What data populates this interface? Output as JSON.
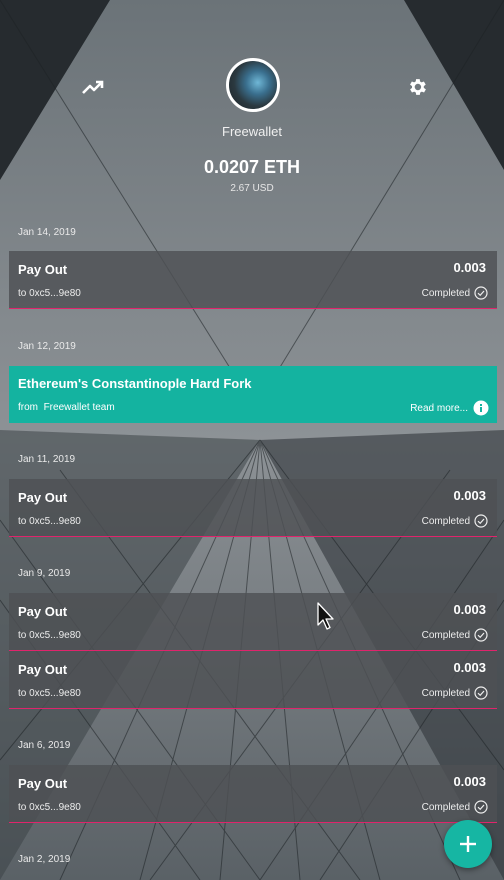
{
  "header": {
    "trend_icon": "trending-up-icon",
    "settings_icon": "gear-icon",
    "wallet_name": "Freewallet",
    "balance": "0.0207 ETH",
    "balance_fiat": "2.67 USD"
  },
  "groups": [
    {
      "date": "Jan 14, 2019"
    },
    {
      "date": "Jan 12, 2019"
    },
    {
      "date": "Jan 11, 2019"
    },
    {
      "date": "Jan 9, 2019"
    },
    {
      "date": "Jan 6, 2019"
    },
    {
      "date": "Jan 2, 2019"
    }
  ],
  "transactions": [
    {
      "title": "Pay Out",
      "amount": "0.003",
      "address": "to  0xc5...9e80",
      "status": "Completed"
    },
    {
      "title": "Pay Out",
      "amount": "0.003",
      "address": "to  0xc5...9e80",
      "status": "Completed"
    },
    {
      "title": "Pay Out",
      "amount": "0.003",
      "address": "to  0xc5...9e80",
      "status": "Completed"
    },
    {
      "title": "Pay Out",
      "amount": "0.003",
      "address": "to  0xc5...9e80",
      "status": "Completed"
    },
    {
      "title": "Pay Out",
      "amount": "0.003",
      "address": "to  0xc5...9e80",
      "status": "Completed"
    }
  ],
  "news": {
    "title": "Ethereum's Constantinople Hard Fork",
    "from_label": "from",
    "from": "Freewallet team",
    "read_more": "Read more...",
    "info_icon": "info-icon"
  },
  "fab_icon": "plus-icon",
  "colors": {
    "accent": "#14b3a0",
    "divider": "#e0246c",
    "card": "#4e5054"
  }
}
